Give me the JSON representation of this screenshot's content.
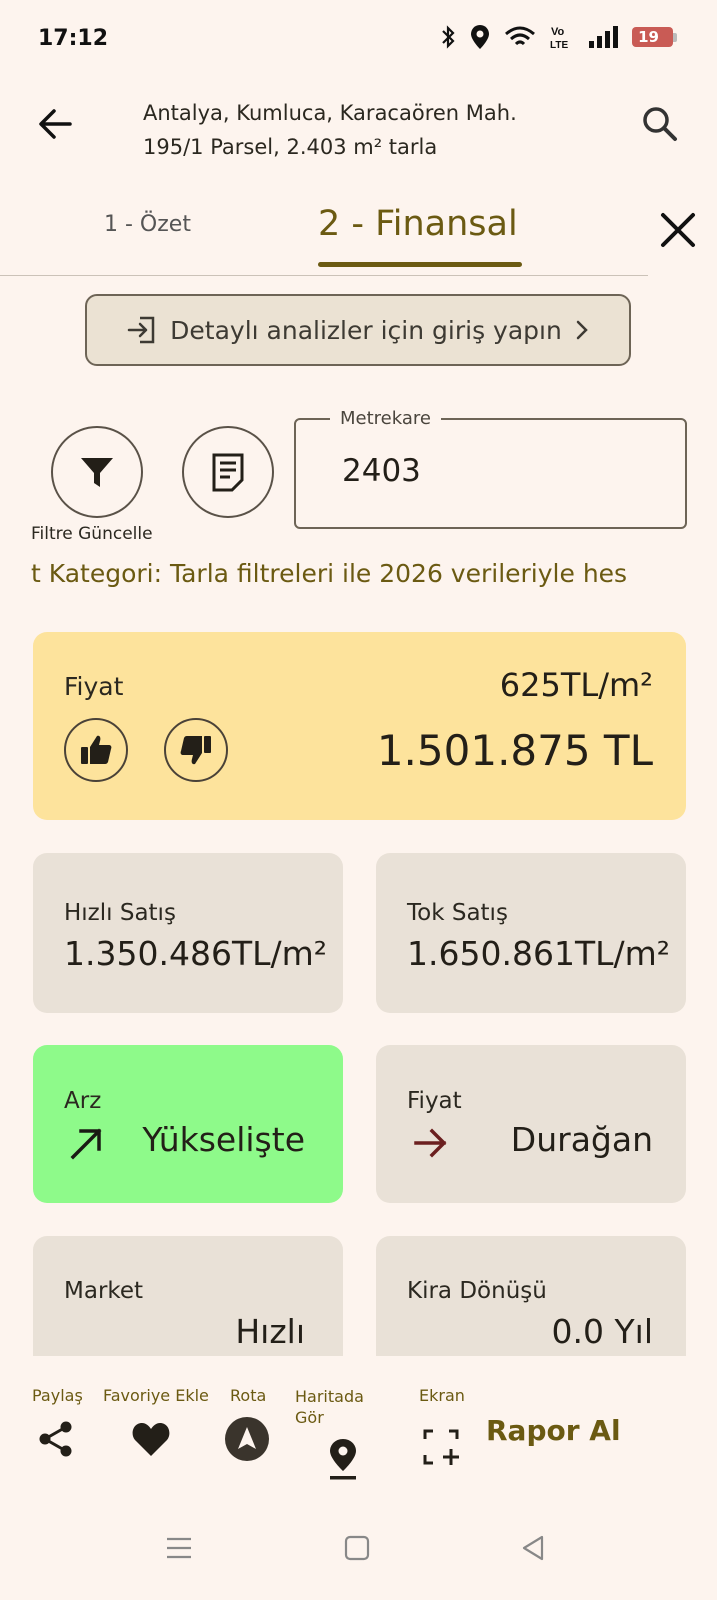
{
  "status_bar": {
    "time": "17:12",
    "battery": "19"
  },
  "header": {
    "title_line1": "Antalya, Kumluca, Karacaören Mah.",
    "title_line2": "195/1 Parsel, 2.403 m² tarla"
  },
  "tabs": [
    {
      "label": "1 - Özet",
      "active": false
    },
    {
      "label": "2 - Finansal",
      "active": true
    }
  ],
  "login_banner": {
    "label": "Detaylı analizler için giriş yapın"
  },
  "filter": {
    "label": "Filtre Güncelle"
  },
  "metrekare": {
    "label": "Metrekare",
    "value": "2403"
  },
  "marquee_text": "t Kategori: Tarla filtreleri ile 2026 verileriyle hes",
  "price": {
    "label": "Fiyat",
    "per_m2": "625TL/m²",
    "total": "1.501.875 TL"
  },
  "stats": {
    "hizli_satis": {
      "label": "Hızlı Satış",
      "value": "1.350.486TL/m²"
    },
    "tok_satis": {
      "label": "Tok Satış",
      "value": "1.650.861TL/m²"
    },
    "arz": {
      "label": "Arz",
      "value": "Yükselişte"
    },
    "fiyat": {
      "label": "Fiyat",
      "value": "Durağan"
    },
    "market": {
      "label": "Market",
      "value": "Hızlı"
    },
    "kira": {
      "label": "Kira Dönüşü",
      "value": "0.0 Yıl"
    }
  },
  "actions": {
    "share": "Paylaş",
    "favorite": "Favoriye Ekle",
    "route": "Rota",
    "map_line1": "Haritada",
    "map_line2": "Gör",
    "screen": "Ekran",
    "report": "Rapor Al"
  },
  "colors": {
    "accent": "#6b5a12",
    "price_card": "#fde39c",
    "arz_card": "#8efa8a",
    "card_bg": "#e9e1d7",
    "background": "#fdf4ee"
  }
}
